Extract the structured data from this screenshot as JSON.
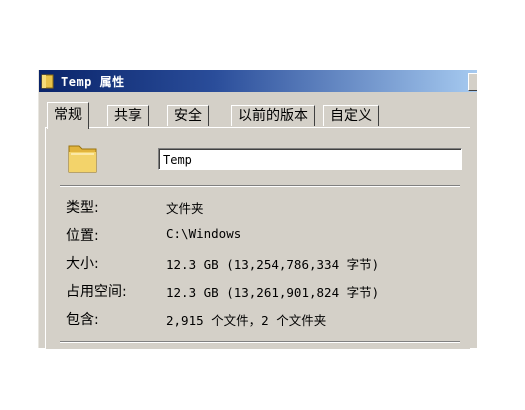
{
  "window": {
    "title": "Temp 属性",
    "accent_color": "#0a246a",
    "face_color": "#d4d0c8",
    "icon": "folder-icon"
  },
  "tabs": [
    {
      "label": "常规",
      "active": true
    },
    {
      "label": "共享",
      "active": false
    },
    {
      "label": "安全",
      "active": false
    },
    {
      "label": "以前的版本",
      "active": false
    },
    {
      "label": "自定义",
      "active": false
    }
  ],
  "general": {
    "folder_icon": "folder-icon",
    "name_value": "Temp",
    "properties": [
      {
        "label": "类型:",
        "value": "文件夹"
      },
      {
        "label": "位置:",
        "value": "C:\\Windows"
      },
      {
        "label": "大小:",
        "value": "12.3 GB (13,254,786,334 字节)"
      },
      {
        "label": "占用空间:",
        "value": "12.3 GB (13,261,901,824 字节)"
      },
      {
        "label": "包含:",
        "value": "2,915 个文件，2 个文件夹"
      }
    ]
  }
}
